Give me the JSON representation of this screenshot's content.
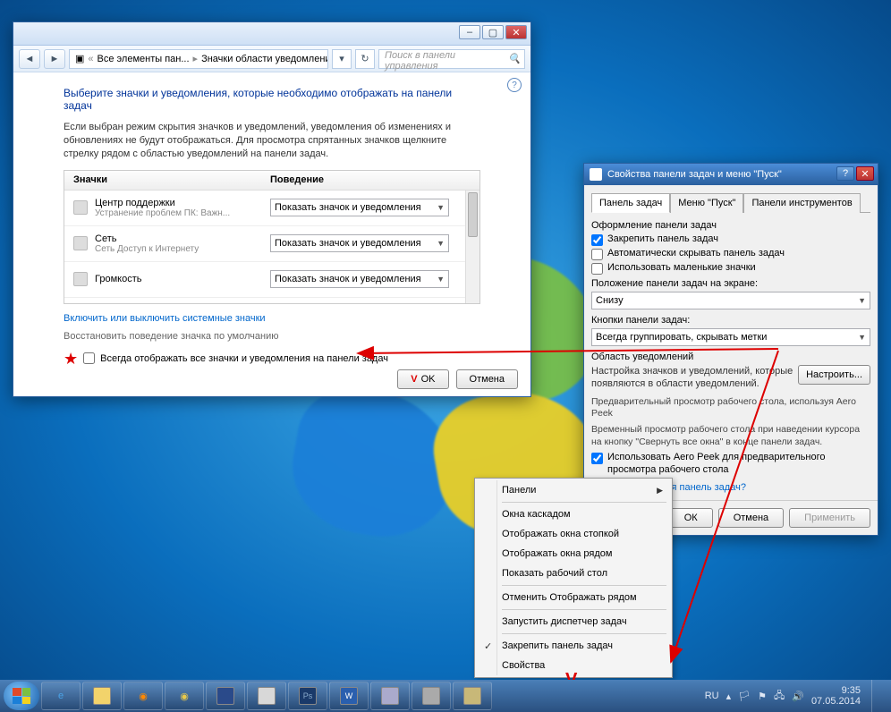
{
  "win1": {
    "breadcrumb": {
      "part1": "Все элементы пан...",
      "part2": "Значки области уведомлений"
    },
    "search_placeholder": "Поиск в панели управления",
    "title": "Выберите значки и уведомления, которые необходимо отображать на панели задач",
    "description": "Если выбран режим скрытия значков и уведомлений, уведомления об изменениях и обновлениях не будут отображаться. Для просмотра спрятанных значков щелкните стрелку рядом с областью уведомлений на панели задач.",
    "col_icons": "Значки",
    "col_behavior": "Поведение",
    "rows": [
      {
        "name": "Центр поддержки",
        "meta": "Устранение проблем ПК: Важн...",
        "value": "Показать значок и уведомления"
      },
      {
        "name": "Сеть",
        "meta": "Сеть Доступ к Интернету",
        "value": "Показать значок и уведомления"
      },
      {
        "name": "Громкость",
        "meta": "",
        "value": "Показать значок и уведомления"
      }
    ],
    "link_sys": "Включить или выключить системные значки",
    "restore": "Восстановить поведение значка по умолчанию",
    "always_show": "Всегда отображать все значки и уведомления на панели задач",
    "ok": "OK",
    "cancel": "Отмена"
  },
  "win2": {
    "title": "Свойства панели задач и меню \"Пуск\"",
    "tabs": [
      "Панель задач",
      "Меню \"Пуск\"",
      "Панели инструментов"
    ],
    "design_label": "Оформление панели задач",
    "chk_lock": "Закрепить панель задач",
    "chk_autohide": "Автоматически скрывать панель задач",
    "chk_small": "Использовать маленькие значки",
    "position_label": "Положение панели задач на экране:",
    "position_value": "Снизу",
    "buttons_label": "Кнопки панели задач:",
    "buttons_value": "Всегда группировать, скрывать метки",
    "notif_label": "Область уведомлений",
    "notif_desc": "Настройка значков и уведомлений, которые появляются в области уведомлений.",
    "configure": "Настроить...",
    "peek_title": "Предварительный просмотр рабочего стола, используя Aero Peek",
    "peek_desc": "Временный просмотр рабочего стола при наведении курсора на кнопку \"Свернуть все окна\" в конце панели задач.",
    "chk_peek": "Использовать Aero Peek для предварительного просмотра рабочего стола",
    "help_link": "Как настраивается панель задач?",
    "ok": "ОК",
    "cancel": "Отмена",
    "apply": "Применить"
  },
  "ctx": {
    "panels": "Панели",
    "cascade": "Окна каскадом",
    "stack": "Отображать окна стопкой",
    "side": "Отображать окна рядом",
    "showdesk": "Показать рабочий стол",
    "undo": "Отменить Отображать рядом",
    "taskman": "Запустить диспетчер задач",
    "lock": "Закрепить панель задач",
    "props": "Свойства"
  },
  "tray": {
    "lang": "RU",
    "time": "9:35",
    "date": "07.05.2014"
  }
}
